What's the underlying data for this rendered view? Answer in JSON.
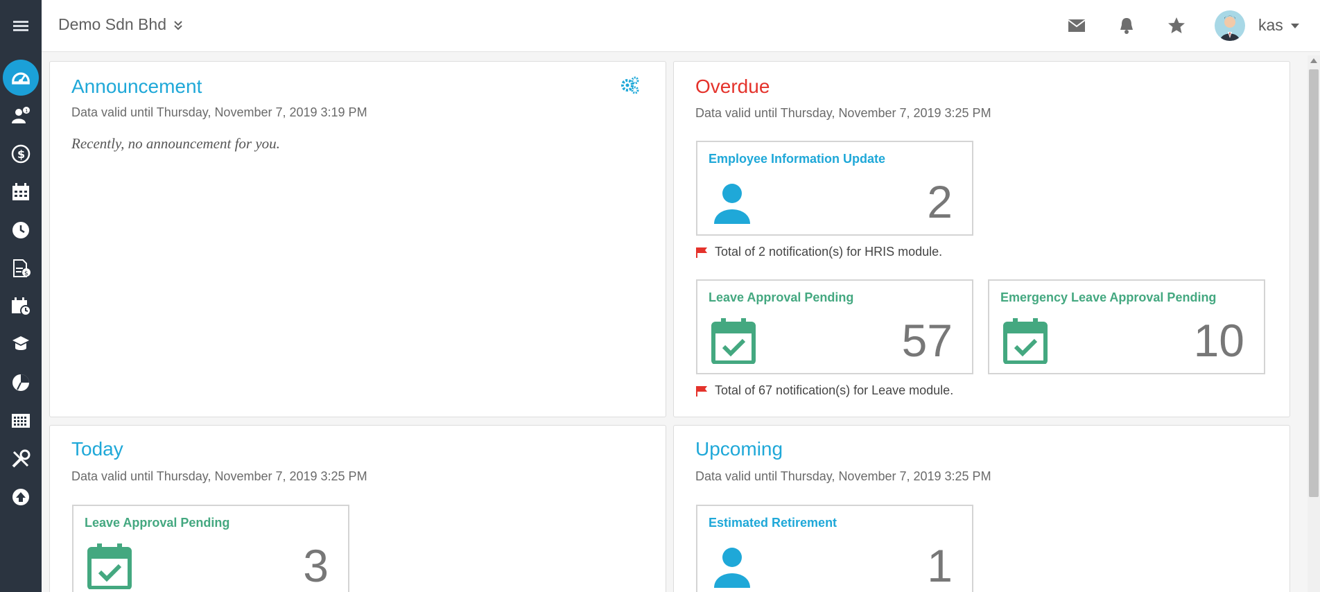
{
  "header": {
    "company": "Demo Sdn Bhd",
    "username": "kas",
    "icons": [
      "envelope-icon",
      "bell-icon",
      "star-icon"
    ]
  },
  "sidebar": {
    "items": [
      {
        "name": "menu-icon"
      },
      {
        "name": "dashboard-icon"
      },
      {
        "name": "employee-info-icon"
      },
      {
        "name": "payroll-icon"
      },
      {
        "name": "leave-calendar-icon"
      },
      {
        "name": "attendance-clock-icon"
      },
      {
        "name": "claim-document-icon"
      },
      {
        "name": "schedule-icon"
      },
      {
        "name": "training-icon"
      },
      {
        "name": "report-chart-icon"
      },
      {
        "name": "grid-table-icon"
      },
      {
        "name": "tools-icon"
      },
      {
        "name": "upload-icon"
      }
    ]
  },
  "announcement": {
    "title": "Announcement",
    "subtitle": "Data valid until Thursday, November 7, 2019 3:19 PM",
    "message": "Recently, no announcement for you."
  },
  "overdue": {
    "title": "Overdue",
    "subtitle": "Data valid until Thursday, November 7, 2019 3:25 PM",
    "cards": [
      {
        "title": "Employee Information Update",
        "count": "2"
      },
      {
        "title": "Leave Approval Pending",
        "count": "57"
      },
      {
        "title": "Emergency Leave Approval Pending",
        "count": "10"
      }
    ],
    "notes": [
      "Total of 2 notification(s) for HRIS module.",
      "Total of 67 notification(s) for Leave module."
    ]
  },
  "today": {
    "title": "Today",
    "subtitle": "Data valid until Thursday, November 7, 2019 3:25 PM",
    "cards": [
      {
        "title": "Leave Approval Pending",
        "count": "3"
      }
    ]
  },
  "upcoming": {
    "title": "Upcoming",
    "subtitle": "Data valid until Thursday, November 7, 2019 3:25 PM",
    "cards": [
      {
        "title": "Estimated Retirement",
        "count": "1"
      }
    ]
  },
  "colors": {
    "accent": "#1fa8d8",
    "overdue": "#e4322b",
    "green": "#44a880",
    "sidebar": "#2b3440"
  }
}
